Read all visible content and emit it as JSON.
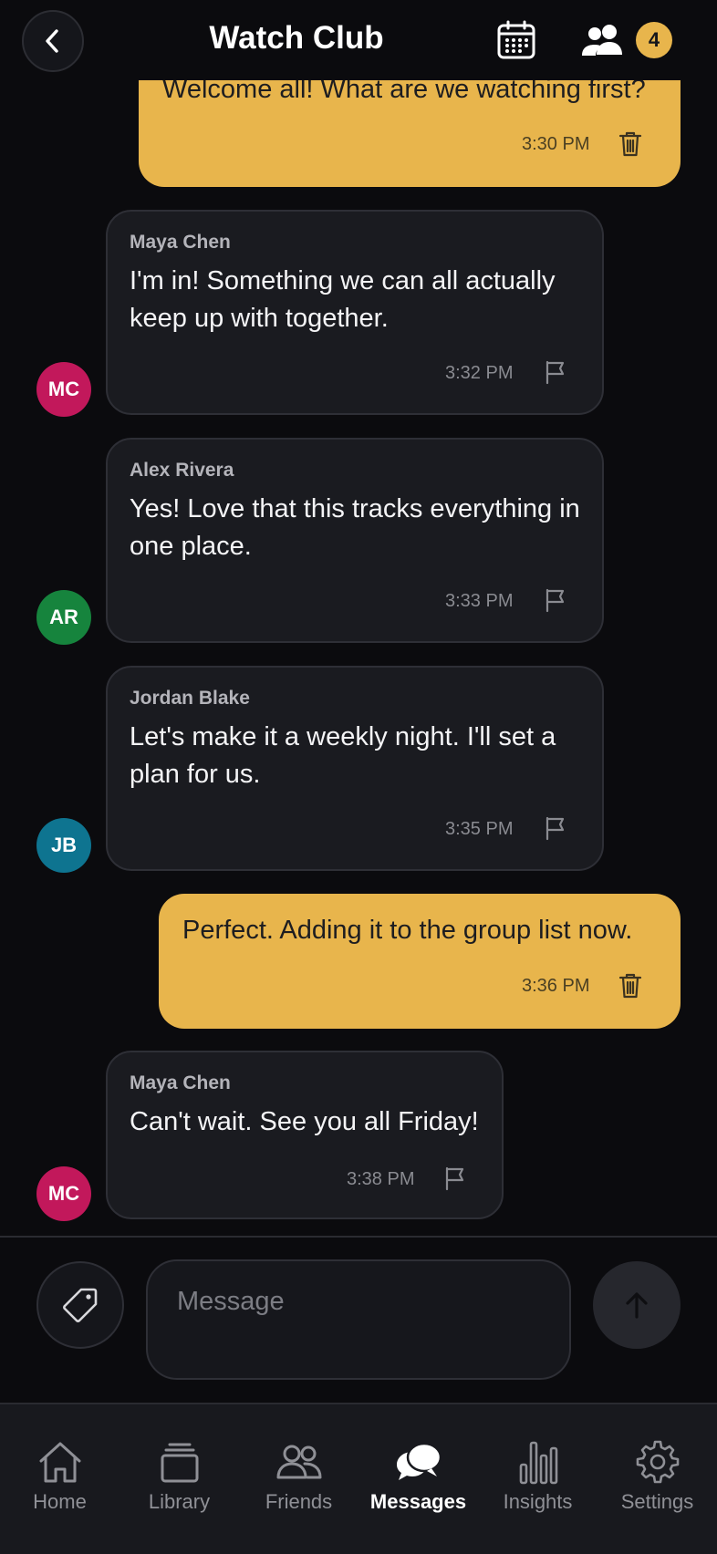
{
  "header": {
    "title": "Watch Club",
    "member_count": "4",
    "back_icon": "chevron-left-icon",
    "calendar_icon": "calendar-icon",
    "members_icon": "people-icon"
  },
  "messages": [
    {
      "type": "outgoing",
      "text": "Welcome all! What are we watching first?",
      "time": "3:30 PM"
    },
    {
      "type": "incoming",
      "sender": "Maya Chen",
      "initials": "MC",
      "avatar_color": "#c2185b",
      "text": "I'm in! Something we can all actually keep up with together.",
      "time": "3:32 PM"
    },
    {
      "type": "incoming",
      "sender": "Alex Rivera",
      "initials": "AR",
      "avatar_color": "#16843d",
      "text": "Yes! Love that this tracks everything in one place.",
      "time": "3:33 PM"
    },
    {
      "type": "incoming",
      "sender": "Jordan Blake",
      "initials": "JB",
      "avatar_color": "#0e7490",
      "text": "Let's make it a weekly night. I'll set a plan for us.",
      "time": "3:35 PM"
    },
    {
      "type": "outgoing",
      "text": "Perfect. Adding it to the group list now.",
      "time": "3:36 PM"
    },
    {
      "type": "incoming",
      "sender": "Maya Chen",
      "initials": "MC",
      "avatar_color": "#c2185b",
      "text": "Can't wait. See you all Friday!",
      "time": "3:38 PM"
    }
  ],
  "composer": {
    "placeholder": "Message",
    "tag_icon": "tag-icon",
    "send_icon": "arrow-up-icon"
  },
  "nav": {
    "items": [
      {
        "label": "Home",
        "icon": "home-icon"
      },
      {
        "label": "Library",
        "icon": "library-icon"
      },
      {
        "label": "Friends",
        "icon": "friends-icon"
      },
      {
        "label": "Messages",
        "icon": "chat-bubbles-icon",
        "active": true
      },
      {
        "label": "Insights",
        "icon": "bar-chart-icon"
      },
      {
        "label": "Settings",
        "icon": "gear-icon"
      }
    ]
  },
  "colors": {
    "accent": "#e8b54c",
    "background": "#0b0b0e",
    "incoming_bubble": "#1a1b20"
  }
}
